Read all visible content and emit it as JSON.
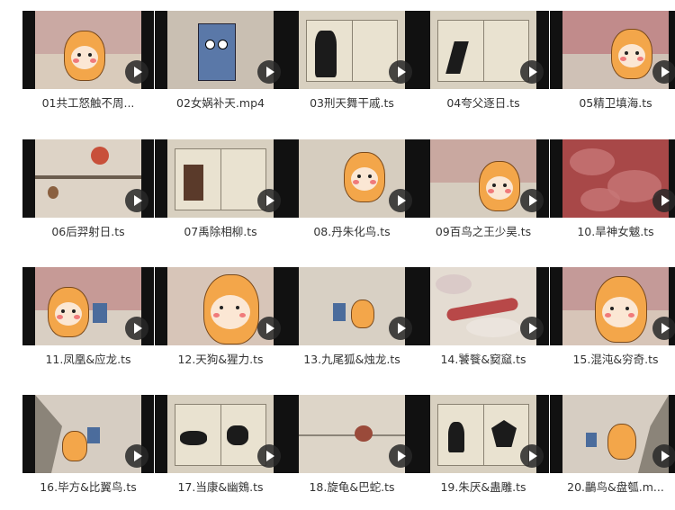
{
  "files": [
    {
      "name": "01共工怒触不周...",
      "scene": "tiger"
    },
    {
      "name": "02女娲补天.mp4",
      "scene": "blue-monster"
    },
    {
      "name": "03刑天舞干戚.ts",
      "scene": "book-warrior"
    },
    {
      "name": "04夸父逐日.ts",
      "scene": "book-runner"
    },
    {
      "name": "05精卫填海.ts",
      "scene": "tiger-red"
    },
    {
      "name": "06后羿射日.ts",
      "scene": "landscape-sun"
    },
    {
      "name": "07禹除相柳.ts",
      "scene": "book-archer"
    },
    {
      "name": "08.丹朱化鸟.ts",
      "scene": "tiger"
    },
    {
      "name": "09百鸟之王少昊.ts",
      "scene": "tiger"
    },
    {
      "name": "10.旱神女魃.ts",
      "scene": "red-clouds"
    },
    {
      "name": "11.凤凰&应龙.ts",
      "scene": "tiger-red"
    },
    {
      "name": "12.天狗&猩力.ts",
      "scene": "tiger-closeup"
    },
    {
      "name": "13.九尾狐&烛龙.ts",
      "scene": "tiger-small"
    },
    {
      "name": "14.饕餮&窫窳.ts",
      "scene": "dragon-clouds"
    },
    {
      "name": "15.混沌&穷奇.ts",
      "scene": "tiger-closeup"
    },
    {
      "name": "16.毕方&比翼鸟.ts",
      "scene": "mountains"
    },
    {
      "name": "17.当康&幽鴳.ts",
      "scene": "book-beasts"
    },
    {
      "name": "18.旋龟&巴蛇.ts",
      "scene": "landscape-rider"
    },
    {
      "name": "19.朱厌&蛊雕.ts",
      "scene": "book-monsters"
    },
    {
      "name": "20.鸓鸟&盘瓠.m...",
      "scene": "tiger-mountains"
    }
  ],
  "colors": {
    "bg": "#ffffff",
    "text": "#333333",
    "play": "#282828"
  }
}
